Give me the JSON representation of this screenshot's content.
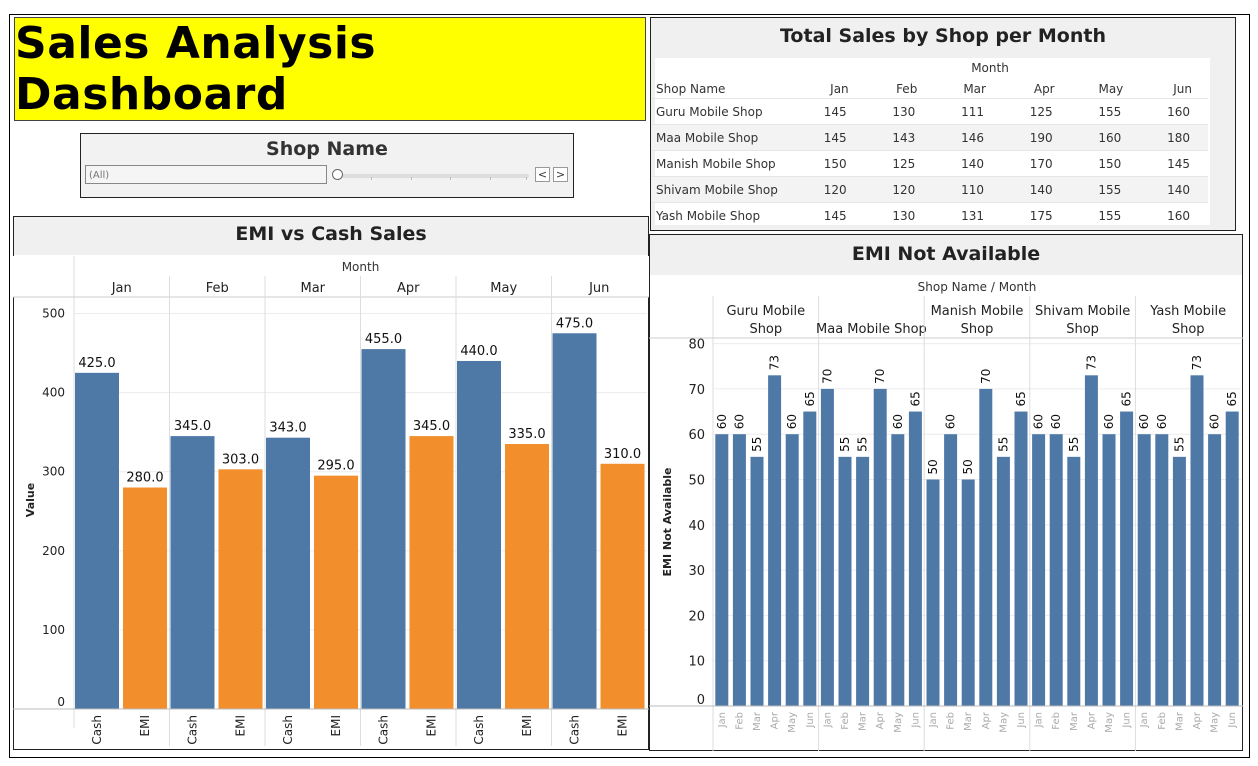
{
  "dashboard": {
    "title": "Sales Analysis Dashboard"
  },
  "filter": {
    "title": "Shop Name",
    "value": "(All)",
    "prev": "<",
    "next": ">"
  },
  "sales_table": {
    "title": "Total Sales by Shop per Month",
    "group_label": "Month",
    "row_header": "Shop Name",
    "months": [
      "Jan",
      "Feb",
      "Mar",
      "Apr",
      "May",
      "Jun"
    ],
    "rows": [
      {
        "shop": "Guru Mobile Shop",
        "values": [
          145,
          130,
          111,
          125,
          155,
          160
        ]
      },
      {
        "shop": "Maa Mobile Shop",
        "values": [
          145,
          143,
          146,
          190,
          160,
          180
        ]
      },
      {
        "shop": "Manish Mobile Shop",
        "values": [
          150,
          125,
          140,
          170,
          150,
          145
        ]
      },
      {
        "shop": "Shivam Mobile Shop",
        "values": [
          120,
          120,
          110,
          140,
          155,
          140
        ]
      },
      {
        "shop": "Yash Mobile Shop",
        "values": [
          145,
          130,
          131,
          175,
          155,
          160
        ]
      }
    ]
  },
  "chart_data": [
    {
      "type": "bar",
      "title": "EMI vs Cash Sales",
      "column_header": "Month",
      "categories": [
        "Jan",
        "Feb",
        "Mar",
        "Apr",
        "May",
        "Jun"
      ],
      "sub_categories": [
        "Cash",
        "EMI"
      ],
      "series": [
        {
          "name": "Cash",
          "values": [
            425,
            345,
            343,
            455,
            440,
            475
          ],
          "labels": [
            "425.0",
            "345.0",
            "343.0",
            "455.0",
            "440.0",
            "475.0"
          ]
        },
        {
          "name": "EMI",
          "values": [
            280,
            303,
            295,
            345,
            335,
            310
          ],
          "labels": [
            "280.0",
            "303.0",
            "295.0",
            "345.0",
            "335.0",
            "310.0"
          ]
        }
      ],
      "ylabel": "Value",
      "ylim": [
        0,
        520
      ],
      "yticks": [
        0,
        100,
        200,
        300,
        400,
        500
      ],
      "colors": {
        "Cash": "#4e79a7",
        "EMI": "#f28e2b"
      },
      "grid": true
    },
    {
      "type": "bar",
      "title": "EMI Not Available",
      "column_header": "Shop Name  /  Month",
      "groups": [
        {
          "name": [
            "Guru Mobile",
            "Shop"
          ],
          "values": [
            60,
            60,
            55,
            73,
            60,
            65
          ]
        },
        {
          "name": [
            "Maa Mobile Shop"
          ],
          "values": [
            70,
            55,
            55,
            70,
            60,
            65
          ]
        },
        {
          "name": [
            "Manish Mobile",
            "Shop"
          ],
          "values": [
            50,
            60,
            50,
            70,
            55,
            65
          ]
        },
        {
          "name": [
            "Shivam Mobile",
            "Shop"
          ],
          "values": [
            60,
            60,
            55,
            73,
            60,
            65
          ]
        },
        {
          "name": [
            "Yash Mobile",
            "Shop"
          ],
          "values": [
            60,
            60,
            55,
            73,
            60,
            65
          ]
        }
      ],
      "months": [
        "Jan",
        "Feb",
        "Mar",
        "Apr",
        "May",
        "Jun"
      ],
      "ylabel": "EMI Not Available",
      "ylim": [
        0,
        82
      ],
      "yticks": [
        0,
        10,
        20,
        30,
        40,
        50,
        60,
        70,
        80
      ],
      "color": "#4e79a7",
      "grid": true
    }
  ]
}
